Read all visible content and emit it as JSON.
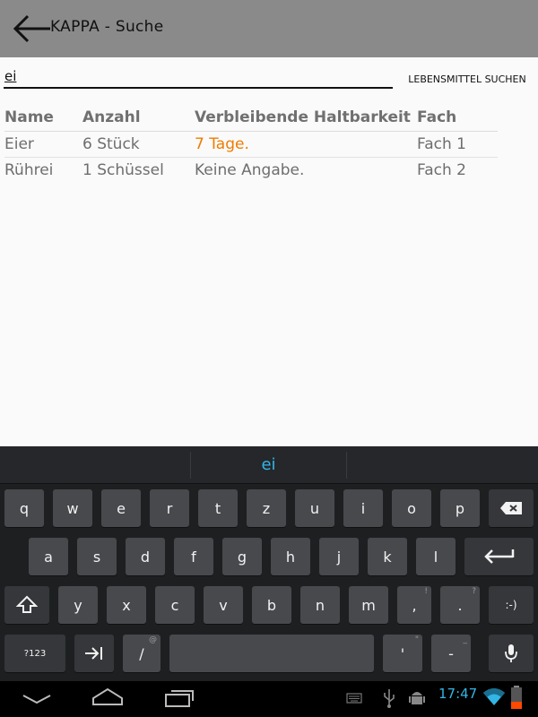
{
  "app": {
    "title": "KAPPA - Suche"
  },
  "search": {
    "value": "ei",
    "button_label": "LEBENSMITTEL SUCHEN"
  },
  "table": {
    "headers": [
      "Name",
      "Anzahl",
      "Verbleibende Haltbarkeit",
      "Fach"
    ],
    "rows": [
      [
        "Eier",
        "6 Stück",
        "7 Tage.",
        "Fach 1"
      ],
      [
        "Rührei",
        "1 Schüssel",
        "Keine Angabe.",
        "Fach 2"
      ]
    ]
  },
  "colors": {
    "warning": "#f07c00",
    "accent": "#33b5e5",
    "actionbar": "#8a8a8a"
  },
  "keyboard": {
    "suggestion": "ei",
    "row1": [
      "q",
      "w",
      "e",
      "r",
      "t",
      "z",
      "u",
      "i",
      "o",
      "p"
    ],
    "row2": [
      "a",
      "s",
      "d",
      "f",
      "g",
      "h",
      "j",
      "k",
      "l"
    ],
    "row3": [
      "y",
      "x",
      "c",
      "v",
      "b",
      "n",
      "m",
      ",",
      "."
    ],
    "row3_hints": [
      "",
      "",
      "",
      "",
      "",
      "",
      "",
      "!",
      "?"
    ],
    "smiley": ":-)",
    "row4": {
      "symbols": "?123",
      "slash": "/",
      "slash_hint": "@",
      "apostrophe": "'",
      "apostrophe_hint": "\"",
      "dash": "-",
      "dash_hint": "_"
    },
    "icons": [
      "backspace-icon",
      "enter-icon",
      "shift-icon",
      "tab-icon",
      "mic-icon"
    ]
  },
  "statusbar": {
    "time": "17:47"
  }
}
